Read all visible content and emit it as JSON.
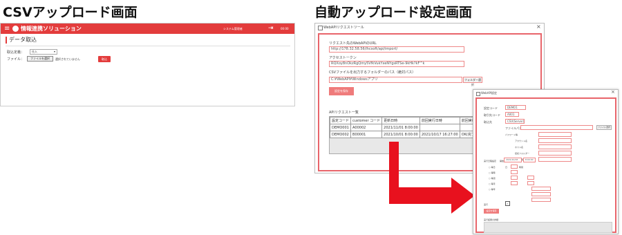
{
  "left_heading": "CSVアップロード画面",
  "right_heading": "自動アップロード設定画面",
  "csv_screen": {
    "app_title": "情報連携ソリューション",
    "system_link": "システム管理者",
    "user_id": "00:00",
    "page_title": "データ取込",
    "type_label": "取込定義：",
    "type_value": "仕入",
    "file_label": "ファイル：",
    "file_button": "ファイルを選択",
    "file_status": "選択されていません",
    "import_button": "取込",
    "accent": "#e33c3c"
  },
  "webapi_window": {
    "title": "WebAPIリクエストツール",
    "close": "×",
    "url_label": "リクエスト先のWebAPIのURL",
    "url_value": "http://178.32.58.56/lhcsoft/api/import/",
    "token_label": "アクセストークン",
    "token_value": "RQXoy8nOkzRgQmy5VfkVukYxeNYgsRTSe-9kHk?kF^k",
    "folder_label": "CSVファイルを出力するフォルダーのパス（絶対パス）",
    "folder_value": "C:¥WebAPI¥Windowsアプリ",
    "folder_button": "フォルダー選択",
    "save_button": "設定を保存",
    "list_label": "APIリクエスト一覧",
    "columns": [
      "設定コード",
      "customer コード",
      "更新日時",
      "前回実行日時",
      "前回実行結果"
    ],
    "rows": [
      [
        "DEMO001",
        "A00002",
        "2021/11/01 8:00:00",
        "",
        ""
      ],
      [
        "DEMO002",
        "B00001",
        "2021/10/01 8:00:00",
        "2021/10/17 16:27:00",
        "OK(完了)"
      ]
    ]
  },
  "settings_window": {
    "title": "WebAPI設定",
    "close": "×",
    "code_label": "設定コード",
    "code_value": "DEMO1",
    "customer_label": "取引先コード",
    "customer_value": "A001",
    "kind_label": "取込先",
    "kind_value": "CSV(Server)",
    "path_label": "ファイルパス",
    "detail_labels": [
      "パスワード等",
      "アカウント名",
      "ホスト名",
      "接続フォルダー",
      "ポート番号"
    ],
    "ref_button": "ファイル選択",
    "schedule_label": "実行日程設定",
    "start_label": "開始",
    "start_date": "2021/10/18",
    "start_time": "8:00:00",
    "radio_options": [
      "毎日",
      "毎時",
      "毎週",
      "毎月",
      "毎年"
    ],
    "day_label": "日",
    "hour_label": "時間",
    "execute_label": "実行",
    "save_button": "設定を保存",
    "log_label": "実行結果の詳細"
  },
  "colors": {
    "accent": "#e33c3c",
    "arrow": "#e8111e",
    "highlight_border": "#e8646a"
  }
}
